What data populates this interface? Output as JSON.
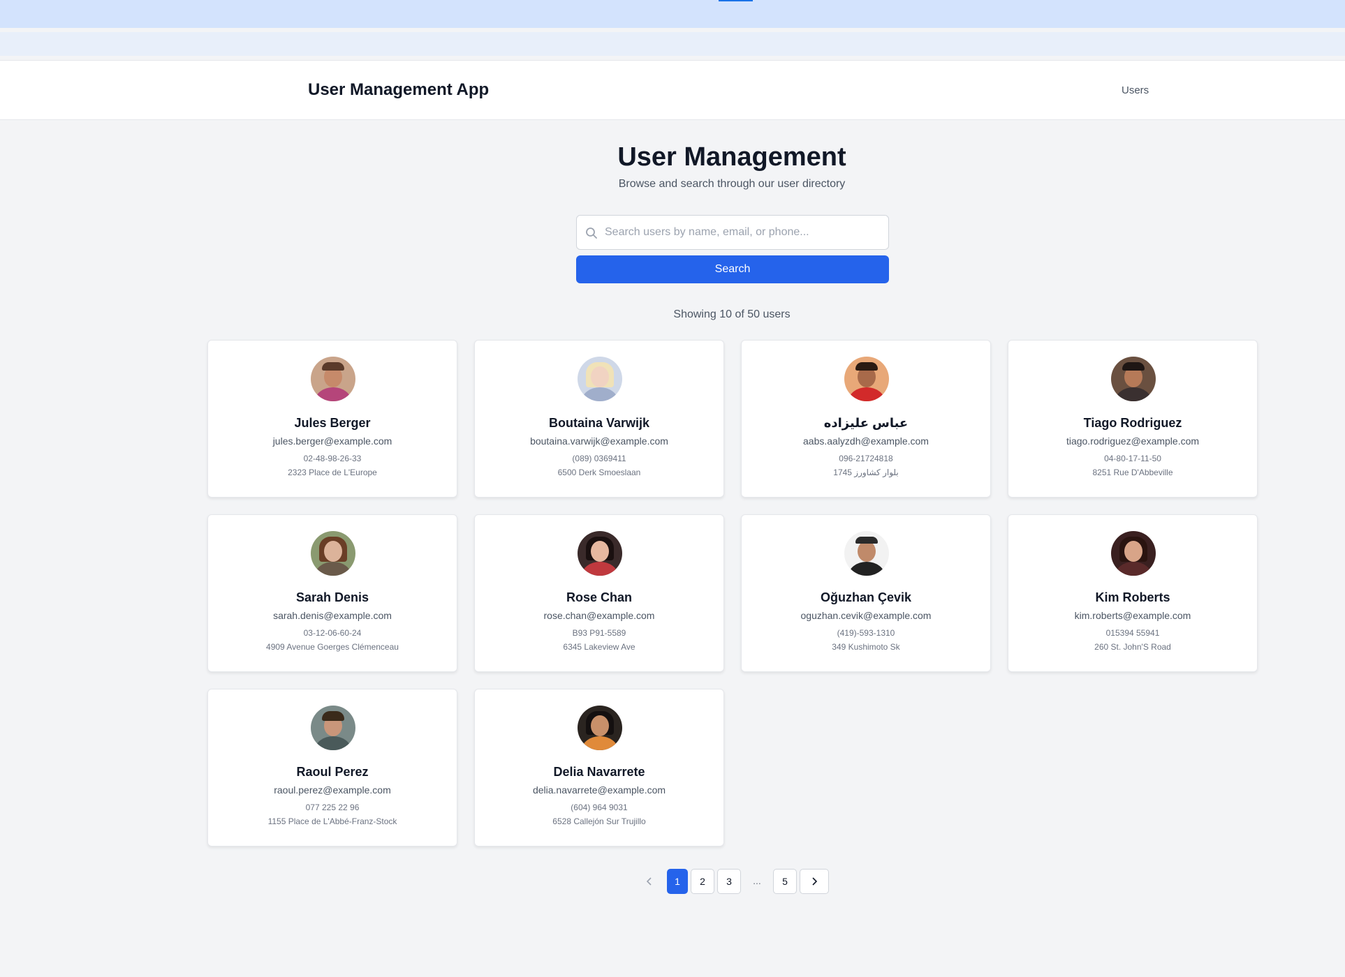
{
  "header": {
    "app_title": "User Management App",
    "nav_users": "Users"
  },
  "main": {
    "title": "User Management",
    "subtitle": "Browse and search through our user directory",
    "search_placeholder": "Search users by name, email, or phone...",
    "search_value": "",
    "search_button": "Search",
    "showing": "Showing 10 of 50 users"
  },
  "users": [
    {
      "name": "Jules Berger",
      "email": "jules.berger@example.com",
      "phone": "02-48-98-26-33",
      "address": "2323 Place de L'Europe"
    },
    {
      "name": "Boutaina Varwijk",
      "email": "boutaina.varwijk@example.com",
      "phone": "(089) 0369411",
      "address": "6500 Derk Smoeslaan"
    },
    {
      "name": "عباس علیزاده",
      "email": "aabs.aalyzdh@example.com",
      "phone": "096-21724818",
      "address": "1745 بلوار کشاورز"
    },
    {
      "name": "Tiago Rodriguez",
      "email": "tiago.rodriguez@example.com",
      "phone": "04-80-17-11-50",
      "address": "8251 Rue D'Abbeville"
    },
    {
      "name": "Sarah Denis",
      "email": "sarah.denis@example.com",
      "phone": "03-12-06-60-24",
      "address": "4909 Avenue Goerges Clémenceau"
    },
    {
      "name": "Rose Chan",
      "email": "rose.chan@example.com",
      "phone": "B93 P91-5589",
      "address": "6345 Lakeview Ave"
    },
    {
      "name": "Oğuzhan Çevik",
      "email": "oguzhan.cevik@example.com",
      "phone": "(419)-593-1310",
      "address": "349 Kushimoto Sk"
    },
    {
      "name": "Kim Roberts",
      "email": "kim.roberts@example.com",
      "phone": "015394 55941",
      "address": "260 St. John'S Road"
    },
    {
      "name": "Raoul Perez",
      "email": "raoul.perez@example.com",
      "phone": "077 225 22 96",
      "address": "1155 Place de L'Abbé-Franz-Stock"
    },
    {
      "name": "Delia Navarrete",
      "email": "delia.navarrete@example.com",
      "phone": "(604) 964 9031",
      "address": "6528 Callejón Sur Trujillo"
    }
  ],
  "pagination": {
    "prev_icon": "chevron-left-icon",
    "next_icon": "chevron-right-icon",
    "pages": [
      "1",
      "2",
      "3",
      "5"
    ],
    "ellipsis": "...",
    "current": "1"
  },
  "colors": {
    "accent": "#2563eb",
    "page_background": "#f3f4f6"
  }
}
